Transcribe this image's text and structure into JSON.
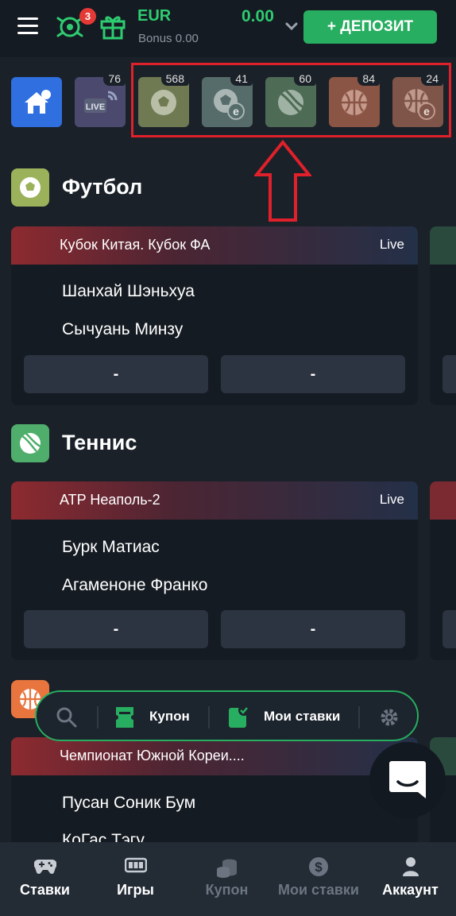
{
  "header": {
    "notification_count": "3",
    "currency": "EUR",
    "bonus": "Bonus 0.00",
    "balance": "0.00",
    "deposit_label": "+ ДЕПОЗИТ"
  },
  "sports_strip": {
    "items": [
      {
        "icon": "home-icon",
        "count": ""
      },
      {
        "icon": "live-icon",
        "count": "76"
      },
      {
        "icon": "football-icon",
        "count": "568"
      },
      {
        "icon": "esports-football-icon",
        "count": "41"
      },
      {
        "icon": "tennis-icon",
        "count": "60"
      },
      {
        "icon": "basketball-icon",
        "count": "84"
      },
      {
        "icon": "esports-basketball-icon",
        "count": "24"
      }
    ]
  },
  "sections": [
    {
      "title": "Футбол",
      "league": "Кубок Китая. Кубок ФА",
      "status": "Live",
      "team1": "Шанхай Шэньхуа",
      "team2": "Сычуань Минзу",
      "odd1": "-",
      "odd2": "-"
    },
    {
      "title": "Теннис",
      "league": "ATP Неаполь-2",
      "status": "Live",
      "team1": "Бурк Матиас",
      "team2": "Агаменоне Франко",
      "odd1": "-",
      "odd2": "-"
    },
    {
      "title": "",
      "league": "Чемпионат Южной Кореи....",
      "status": "",
      "team1": "Пусан Соник Бум",
      "team2": "КоГас Тэгу"
    }
  ],
  "toolbar": {
    "coupon_label": "Купон",
    "my_bets_label": "Мои ставки"
  },
  "bottom_nav": [
    {
      "label": "Ставки",
      "active": true
    },
    {
      "label": "Игры",
      "active": true
    },
    {
      "label": "Купон",
      "active": false
    },
    {
      "label": "Мои ставки",
      "active": false
    },
    {
      "label": "Аккаунт",
      "active": true
    }
  ],
  "colors": {
    "accent": "#27ae60",
    "highlight": "#e0202a",
    "background": "#1a2129"
  }
}
